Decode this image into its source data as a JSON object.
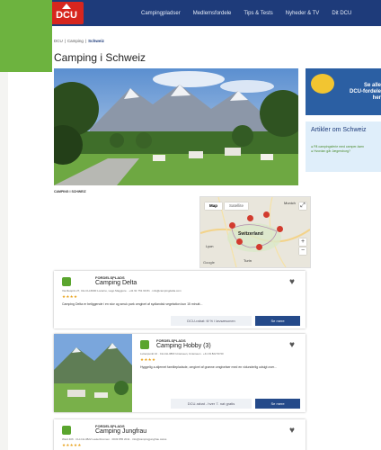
{
  "nav": {
    "logo": "DCU",
    "items": [
      "Campingpladser",
      "Medlemsfordele",
      "Tips & Tests",
      "Nyheder & TV",
      "Dit DCU"
    ]
  },
  "breadcrumb": {
    "home": "DCU",
    "sep": "|",
    "section": "Camping",
    "current": "Schweiz"
  },
  "page_title": "Camping i Schweiz",
  "hero_caption": "CAMPING I SCHWEIZ",
  "sidebar": {
    "ad_line1": "Se alle",
    "ad_line2": "DCU-fordele",
    "ad_line3": "her",
    "articles_title": "Artikler om Schweiz",
    "articles": [
      "På campingsferie med camper-børn",
      "Hvordan går Jægersborg?"
    ]
  },
  "map": {
    "tab_map": "Map",
    "tab_satellite": "Satellite",
    "labels": [
      "Munich",
      "Switzerland",
      "Lyon",
      "Turin"
    ],
    "footer": "Google"
  },
  "cards": [
    {
      "label": "FORDELSPLADS",
      "name": "Camping Delta",
      "address": "Via Respini 27, CH-CH-6600 Locarno, Lago Maggiore · +41 91 751 60 81 · info@campingdelta.com",
      "stars": "★★★★",
      "description": "Camping Delta er beliggende i en stor og smuk park omgivet af sydlandsk vegetation kun 15 minutt...",
      "discount": "DCU-rabat: til % i lavsæsonen",
      "see_more": "Se mere"
    },
    {
      "label": "FORDELSPLADS",
      "name": "Camping Hobby (3)",
      "address": "Luttenpunkt 10 · CH-CH-3800 Unterseen, Unterseen · +41 33 822 50 50",
      "stars": "★★★★",
      "description": "Hyggelig a-stjernet familiepladsde, omgivet af grønne omgivelser med en vidunderlig udsigt over...",
      "discount": "DCU-rabat - hver 7. nat gratis",
      "see_more": "Se mere"
    },
    {
      "label": "FORDELSPLADS",
      "name": "Camping Jungfrau",
      "address": "Weid 406 · CH-CH-3822 Lauterbrunnen · 0033 855 2011 · info@campingjungfrau.swiss",
      "stars": "★★★★★"
    }
  ],
  "colors": {
    "nav": "#1e3b7a",
    "accent_green": "#6db33f",
    "logo_red": "#d7261e",
    "button": "#254a8a"
  }
}
